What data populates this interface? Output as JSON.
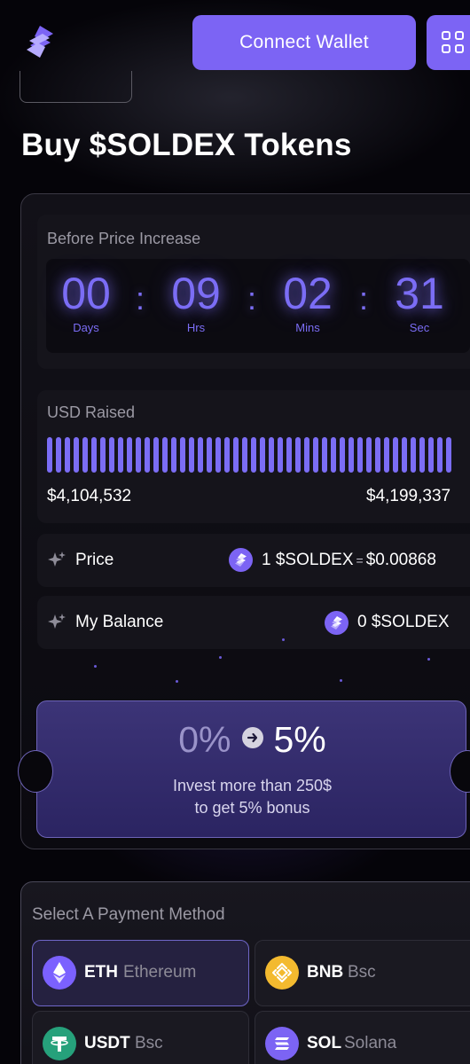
{
  "header": {
    "connect_label": "Connect Wallet"
  },
  "page_title": "Buy $SOLDEX Tokens",
  "countdown": {
    "label": "Before Price Increase",
    "days": "00",
    "days_label": "Days",
    "hours": "09",
    "hours_label": "Hrs",
    "mins": "02",
    "mins_label": "Mins",
    "secs": "31",
    "secs_label": "Sec",
    "separator": ":"
  },
  "raised": {
    "label": "USD Raised",
    "current": "$4,104,532",
    "goal": "$4,199,337"
  },
  "price": {
    "label": "Price",
    "amount": "1 $SOLDEX",
    "equals": "=",
    "usd": "$0.00868"
  },
  "balance": {
    "label": "My Balance",
    "value": "0 $SOLDEX"
  },
  "bonus": {
    "from": "0%",
    "to": "5%",
    "line1": "Invest more than 250$",
    "line2": "to get 5% bonus"
  },
  "payment": {
    "title": "Select A Payment Method",
    "options": [
      {
        "code": "ETH",
        "network": "Ethereum",
        "icon": "ethereum-icon",
        "color": "#7b61ff",
        "selected": true
      },
      {
        "code": "BNB",
        "network": "Bsc",
        "icon": "bnb-icon",
        "color": "#f3ba2f",
        "selected": false
      },
      {
        "code": "USDT",
        "network": "Bsc",
        "icon": "tether-icon",
        "color": "#26a17b",
        "selected": false
      },
      {
        "code": "SOL",
        "network": "Solana",
        "icon": "solana-icon",
        "color": "#7c64f4",
        "selected": false
      }
    ]
  },
  "colors": {
    "accent": "#7c64f4",
    "timer_glow": "#7b6df5",
    "ticket_bg": "#342d6e"
  }
}
